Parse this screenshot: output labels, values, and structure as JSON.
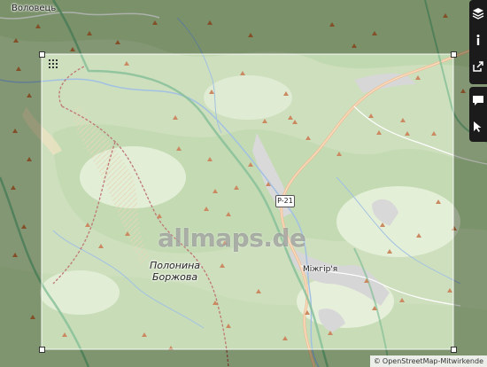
{
  "map": {
    "places": {
      "volovets": "Воловець",
      "polonyna_line1": "Полонина",
      "polonyna_line2": "Боржова",
      "mizhhiria": "Міжгір'я"
    },
    "road_label": "P-21",
    "watermark": "allmaps.de",
    "attribution": {
      "symbol": "©",
      "text": "OpenStreetMap-Mitwirkende"
    },
    "colors": {
      "outer_tint": "#8a9a7a",
      "inner_map": "#cfe3bf",
      "forest": "#b8d7a3",
      "main_road": "#e9a26a",
      "border_line": "#4ea36a",
      "river": "#7aa6d6",
      "peak": "#b5561e",
      "trail": "#a33b3b"
    }
  },
  "toolbar": {
    "buttons": [
      {
        "name": "layers-button",
        "icon": "layers-icon"
      },
      {
        "name": "info-button",
        "icon": "info-icon"
      },
      {
        "name": "share-button",
        "icon": "share-icon"
      },
      {
        "name": "comment-button",
        "icon": "comment-icon"
      },
      {
        "name": "pointer-button",
        "icon": "pointer-icon"
      }
    ]
  }
}
